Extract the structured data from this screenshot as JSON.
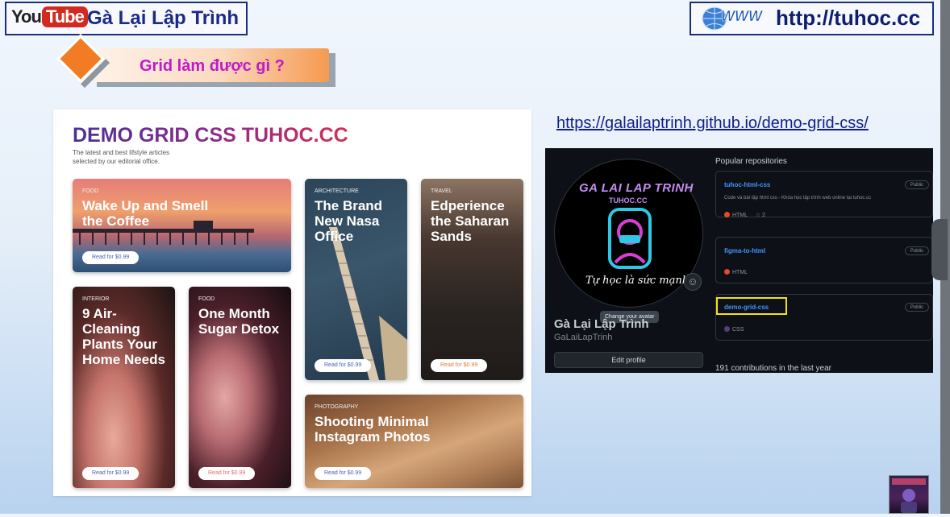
{
  "header": {
    "youtube_you": "You",
    "youtube_tube": "Tube",
    "channel_name": "Gà Lại Lập Trình",
    "website_url": "http://tuhoc.cc"
  },
  "slide": {
    "title": "Grid làm được gì ?"
  },
  "demo": {
    "heading_part1": "DEMO GRID ",
    "heading_part2": "CSS TUHOC.CC",
    "subtitle": "The latest and best lifstyle articles selected by our editorial office.",
    "cards": [
      {
        "tag": "FOOD",
        "title": "Wake Up and Smell the Coffee",
        "button": "Read for $0.99"
      },
      {
        "tag": "ARCHITECTURE",
        "title": "The Brand New Nasa Office",
        "button": "Read for $0.99"
      },
      {
        "tag": "TRAVEL",
        "title": "Edperience the Saharan Sands",
        "button": "Read for $0.99"
      },
      {
        "tag": "INTERIOR",
        "title": "9 Air-Cleaning Plants Your Home Needs",
        "button": "Read for $0.99"
      },
      {
        "tag": "FOOD",
        "title": "One Month Sugar Detox",
        "button": "Read for $0.99"
      },
      {
        "tag": "PHOTOGRAPHY",
        "title": "Shooting Minimal Instagram Photos",
        "button": "Read for $0.99"
      }
    ]
  },
  "link": {
    "url": "https://galailaptrinh.github.io/demo-grid-css/"
  },
  "github": {
    "avatar_title": "GA LAI LAP TRINH",
    "avatar_subtitle": "TUHOC.CC",
    "avatar_signature": "Tự học là sức mạnh",
    "avatar_tooltip": "Change your avatar",
    "display_name": "Gà Lại Lập Trình",
    "username": "GaLaiLapTrinh",
    "edit_profile": "Edit profile",
    "popular_heading": "Popular repositories",
    "repos": [
      {
        "name": "tuhoc-html-css",
        "description": "Code và bài tập html css - Khóa học lập trình web online tại tuhoc.cc",
        "language": "HTML",
        "stars": "2",
        "visibility": "Public",
        "lang_color": "#e34c26"
      },
      {
        "name": "figma-to-html",
        "description": "",
        "language": "HTML",
        "stars": "",
        "visibility": "Public",
        "lang_color": "#e34c26"
      },
      {
        "name": "demo-grid-css",
        "description": "",
        "language": "CSS",
        "stars": "",
        "visibility": "Public",
        "lang_color": "#563d7c"
      }
    ],
    "contributions": "191 contributions in the last year"
  }
}
